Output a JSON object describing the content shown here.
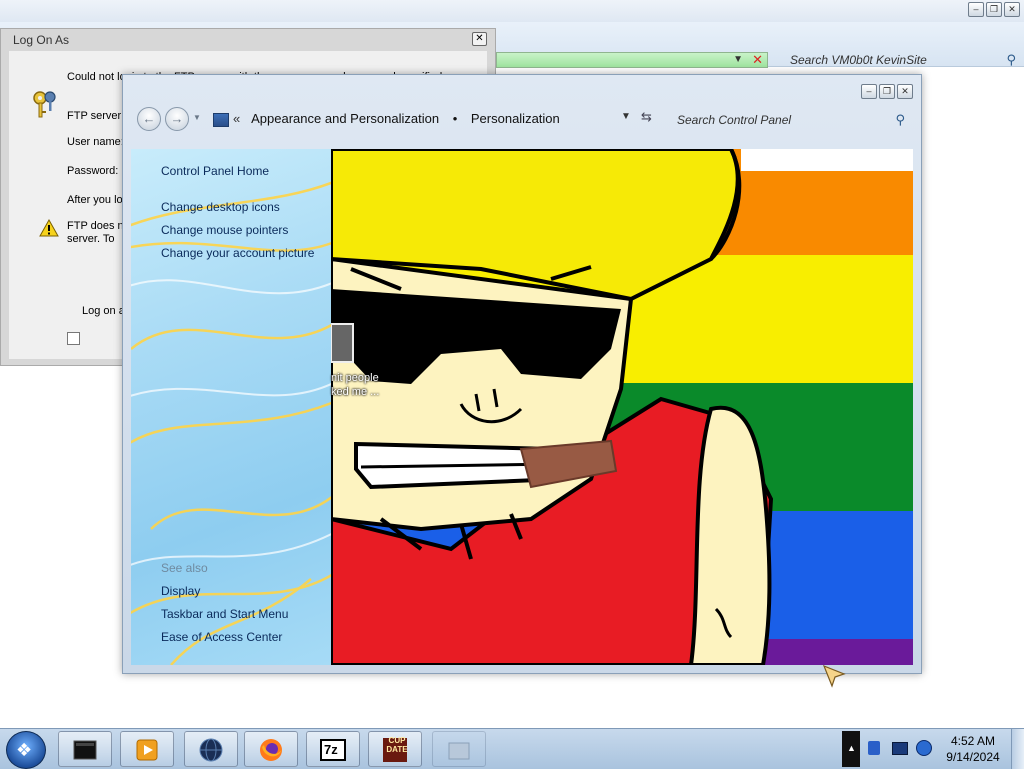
{
  "background_window": {
    "search_placeholder": "Search VM0b0t KevinSite"
  },
  "logon_dialog": {
    "title": "Log On As",
    "message": "Could not login to the FTP server with the user name and password specified.",
    "ftp_server_label": "FTP server:",
    "user_name_label": "User name:",
    "password_label": "Password:",
    "after_label": "After you lo",
    "warning_line1": "FTP does no",
    "warning_line2": "server.  To",
    "checkbox_label": "Log on a"
  },
  "personalization": {
    "breadcrumb": {
      "chevron": "«",
      "parent": "Appearance and Personalization",
      "separator": "•",
      "current": "Personalization"
    },
    "search_placeholder": "Search Control Panel",
    "sidebar": {
      "home": "Control Panel Home",
      "links": [
        "Change desktop icons",
        "Change mouse pointers",
        "Change your account picture"
      ],
      "see_also_header": "See also",
      "see_also": [
        "Display",
        "Taskbar and Start Menu",
        "Ease of Access Center"
      ]
    }
  },
  "desktop_icon": {
    "label_line1": "nit people",
    "label_line2": "ked me ..."
  },
  "taskbar": {
    "items": [
      {
        "icon": "terminal-icon"
      },
      {
        "icon": "media-player-icon"
      },
      {
        "icon": "globe-icon"
      },
      {
        "icon": "firefox-icon"
      },
      {
        "icon": "7zip-icon",
        "text": "7z"
      },
      {
        "icon": "cup-date-icon",
        "text": "CUP DATE"
      },
      {
        "icon": "blank-window-icon"
      }
    ],
    "time": "4:52 AM",
    "date": "9/14/2024"
  },
  "colors": {
    "rainbow": [
      "#f98a00",
      "#f8ee00",
      "#0a8a2a",
      "#1a5fe8",
      "#6a1a9a"
    ],
    "skin": "#fdf3c0",
    "hair": "#f6ea06",
    "shirt": "#e81c24",
    "cigar": "#985a44"
  }
}
